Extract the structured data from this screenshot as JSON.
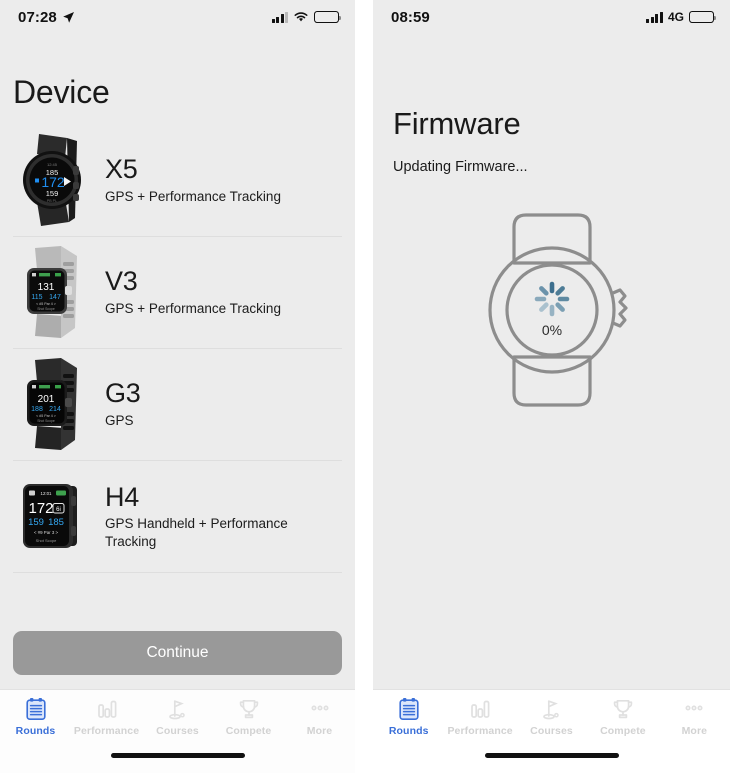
{
  "left_phone": {
    "status_bar": {
      "time": "07:28",
      "location_icon": "location-arrow-icon",
      "signal_icon": "cellular-signal-icon",
      "wifi_icon": "wifi-icon",
      "battery_icon": "battery-full-icon"
    },
    "title": "Device",
    "devices": [
      {
        "name": "X5",
        "desc": "GPS + Performance Tracking",
        "image": "watch-x5-black-round",
        "screen": {
          "top": "185",
          "main": "172",
          "bottom": "159"
        }
      },
      {
        "name": "V3",
        "desc": "GPS + Performance Tracking",
        "image": "watch-v3-grey-square",
        "screen": {
          "main": "131",
          "left": "115",
          "right": "147",
          "hole": "#5 Par 4"
        }
      },
      {
        "name": "G3",
        "desc": "GPS",
        "image": "watch-g3-black-square",
        "screen": {
          "main": "201",
          "left": "188",
          "right": "214",
          "hole": "#5 Par 4"
        }
      },
      {
        "name": "H4",
        "desc": "GPS Handheld + Performance Tracking",
        "image": "handheld-h4-black",
        "screen": {
          "time": "12:01",
          "main": "172",
          "club": "6i",
          "left": "159",
          "right": "185",
          "hole": "#9 Par 3"
        }
      }
    ],
    "continue_label": "Continue"
  },
  "right_phone": {
    "status_bar": {
      "time": "08:59",
      "signal_icon": "cellular-signal-icon",
      "network": "4G",
      "battery_icon": "battery-full-icon"
    },
    "title": "Firmware",
    "subtitle": "Updating Firmware...",
    "illustration": "smartwatch-outline-icon",
    "progress_label": "0%",
    "spinner_icon": "loading-spinner-icon"
  },
  "tab_bar": {
    "items": [
      {
        "label": "Rounds",
        "icon": "clipboard-rounds-icon",
        "active": true
      },
      {
        "label": "Performance",
        "icon": "bar-chart-icon",
        "active": false
      },
      {
        "label": "Courses",
        "icon": "golf-flag-icon",
        "active": false
      },
      {
        "label": "Compete",
        "icon": "trophy-icon",
        "active": false
      },
      {
        "label": "More",
        "icon": "ellipsis-icon",
        "active": false
      }
    ]
  },
  "colors": {
    "background": "#ececec",
    "accent_blue": "#3a6fd8",
    "button_grey": "#999999",
    "inactive_tab": "#d2d2d2",
    "separator": "#dedede"
  }
}
